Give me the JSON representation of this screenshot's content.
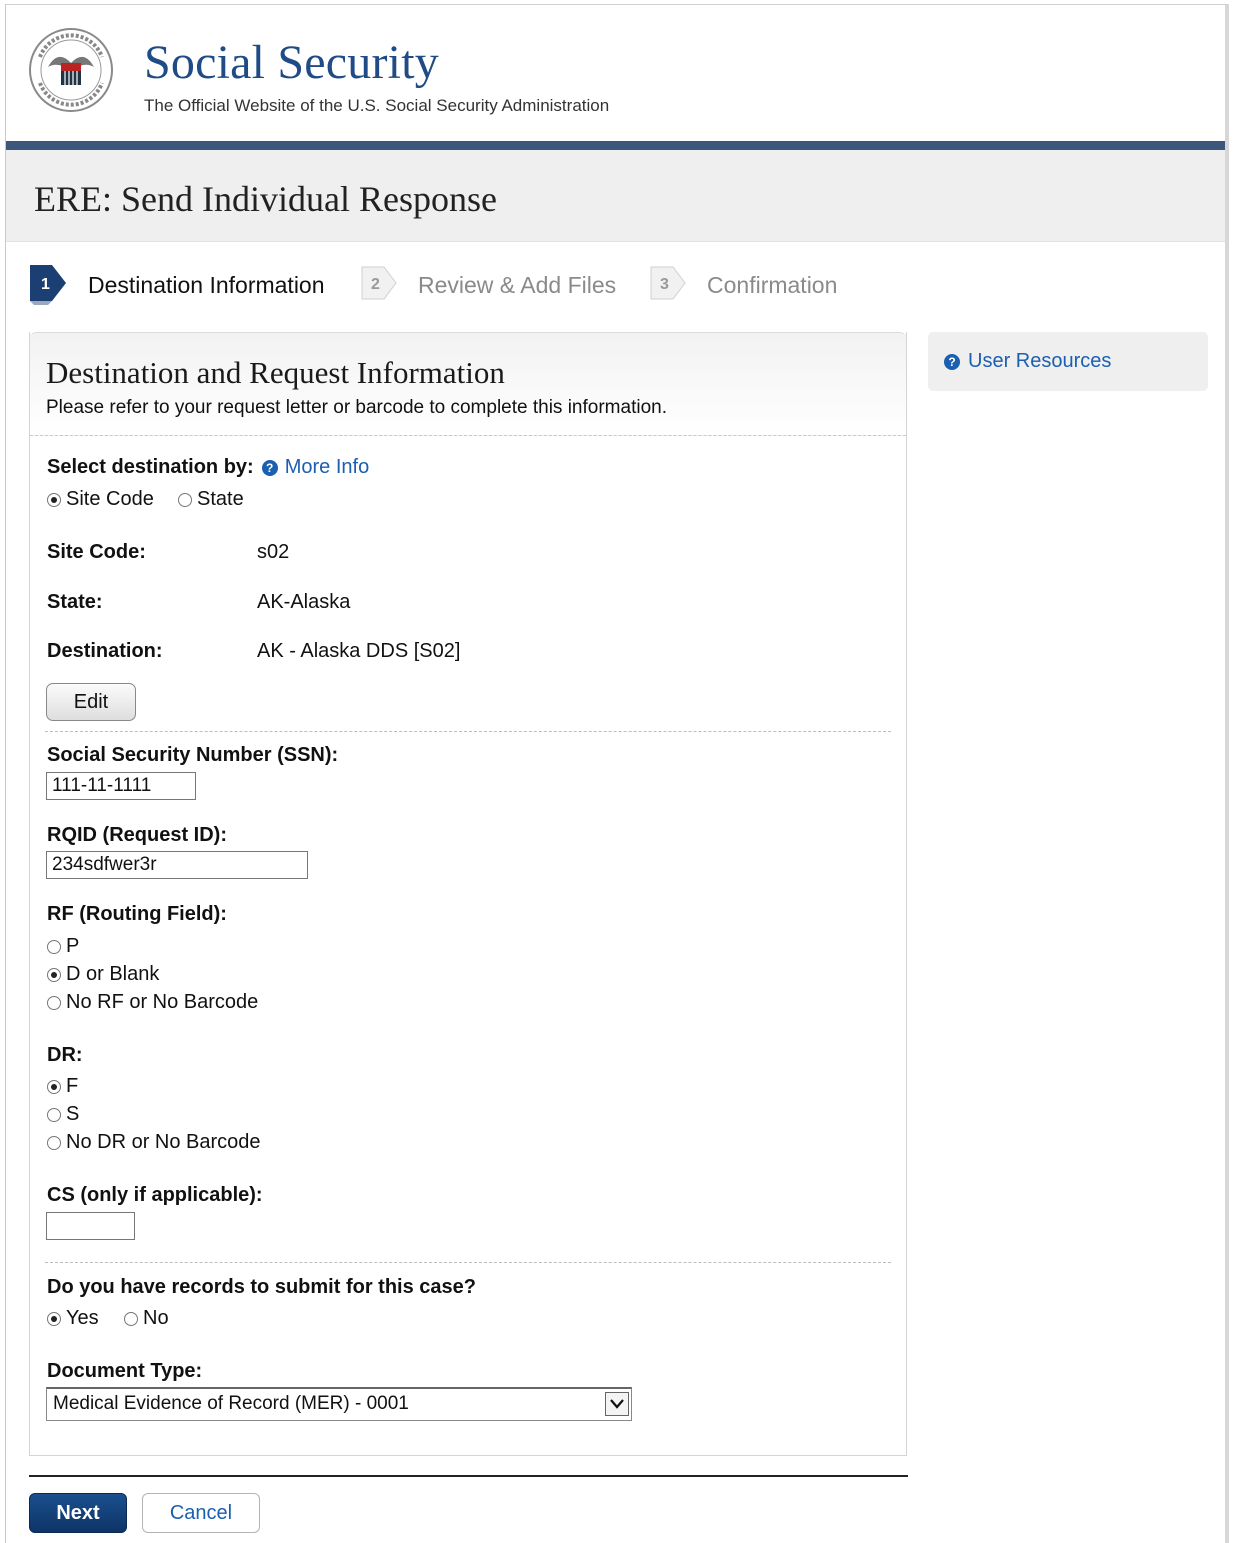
{
  "header": {
    "title": "Social Security",
    "subtitle": "The Official Website of the U.S. Social Security Administration"
  },
  "page": {
    "title": "ERE: Send Individual Response"
  },
  "steps": [
    {
      "number": "1",
      "label": "Destination Information",
      "state": "active"
    },
    {
      "number": "2",
      "label": "Review & Add Files",
      "state": "inactive"
    },
    {
      "number": "3",
      "label": "Confirmation",
      "state": "inactive"
    }
  ],
  "panel": {
    "title": "Destination and Request Information",
    "subtitle": "Please refer to your request letter or barcode to complete this information."
  },
  "destination": {
    "select_label": "Select destination by:",
    "more_info": "More Info",
    "options": [
      "Site Code",
      "State"
    ],
    "selected": "Site Code",
    "site_code_label": "Site Code:",
    "site_code_value": "s02",
    "state_label": "State:",
    "state_value": "AK-Alaska",
    "destination_label": "Destination:",
    "destination_value": "AK - Alaska DDS [S02]",
    "edit_button": "Edit"
  },
  "ssn": {
    "label": "Social Security Number (SSN):",
    "value": "111-11-1111"
  },
  "rqid": {
    "label": "RQID (Request ID):",
    "value": "234sdfwer3r"
  },
  "rf": {
    "label": "RF (Routing Field):",
    "options": [
      "P",
      "D or Blank",
      "No RF or No Barcode"
    ],
    "selected": "D or Blank"
  },
  "dr": {
    "label": "DR:",
    "options": [
      "F",
      "S",
      "No DR or No Barcode"
    ],
    "selected": "F"
  },
  "cs": {
    "label": "CS (only if applicable):",
    "value": ""
  },
  "records": {
    "label": "Do you have records to submit for this case?",
    "options": [
      "Yes",
      "No"
    ],
    "selected": "Yes"
  },
  "doc_type": {
    "label": "Document Type:",
    "value": "Medical Evidence of Record (MER) - 0001"
  },
  "sidebar": {
    "user_resources": "User Resources"
  },
  "actions": {
    "next": "Next",
    "cancel": "Cancel"
  },
  "colors": {
    "brand_blue": "#1f4b86",
    "link_blue": "#1b5fb0",
    "bar": "#3c567d",
    "next_button": "#0e3466"
  },
  "icons": {
    "help": "question-circle-icon",
    "seal": "ssa-seal-icon",
    "select": "chevron-down-icon"
  }
}
